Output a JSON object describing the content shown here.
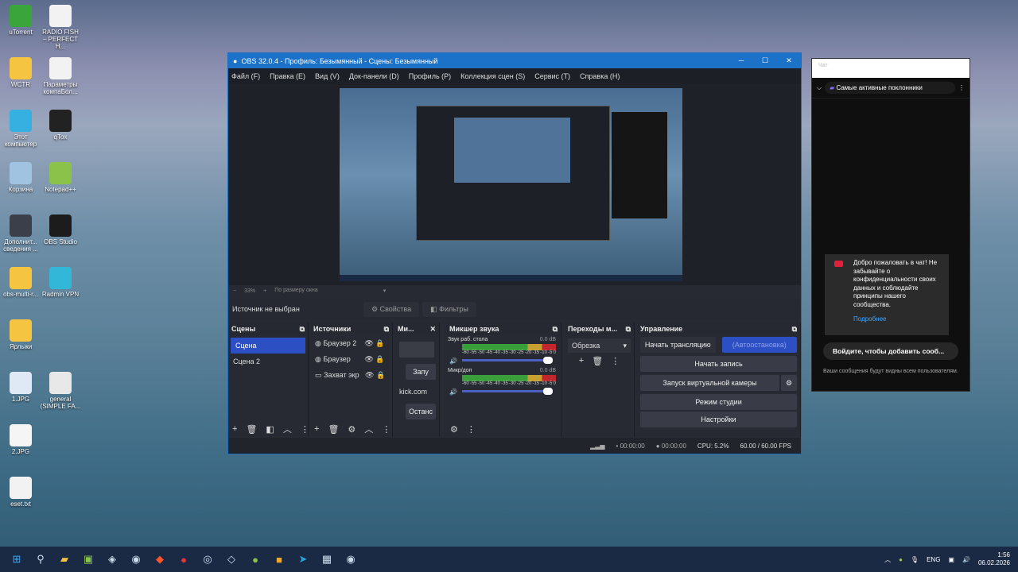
{
  "desktop_icons": [
    {
      "label": "uTorrent",
      "color": "#3aa53a"
    },
    {
      "label": "RADIO FISH – PERFECT H...",
      "color": "#f2f2f2"
    },
    {
      "label": "WCTR",
      "color": "#f5c542"
    },
    {
      "label": "Параметры компаБол...",
      "color": "#f2f2f2"
    },
    {
      "label": "Этот компьютер",
      "color": "#36b0e0"
    },
    {
      "label": "qTox",
      "color": "#222222"
    },
    {
      "label": "Корзина",
      "color": "#9fc3e0"
    },
    {
      "label": "Notepad++",
      "color": "#8bc34a"
    },
    {
      "label": "Дополнит... сведения ...",
      "color": "#3a3f4a"
    },
    {
      "label": "OBS Studio",
      "color": "#1c1c1c"
    },
    {
      "label": "obs-multi-r...",
      "color": "#f5c542"
    },
    {
      "label": "Radmin VPN",
      "color": "#32b7d8"
    },
    {
      "label": "Ярлыки",
      "color": "#f5c542"
    },
    {
      "label": "",
      "color": ""
    },
    {
      "label": "1.JPG",
      "color": "#dfe8f5"
    },
    {
      "label": "general (SIMPLE FA...",
      "color": "#e8e8e8"
    },
    {
      "label": "2.JPG",
      "color": "#f5f5f5"
    },
    {
      "label": "",
      "color": ""
    },
    {
      "label": "eset.txt",
      "color": "#f2f2f2"
    },
    {
      "label": "",
      "color": ""
    }
  ],
  "obs": {
    "title": "OBS 32.0.4 - Профиль: Безымянный - Сцены: Безымянный",
    "menu": [
      "Файл (F)",
      "Правка (E)",
      "Вид (V)",
      "Док-панели (D)",
      "Профиль (P)",
      "Коллекция сцен (S)",
      "Сервис (T)",
      "Справка (H)"
    ],
    "zoom": {
      "minus": "−",
      "value": "33%",
      "plus": "+",
      "fit": "По размеру окна"
    },
    "source_bar": {
      "status": "Источник не выбран",
      "properties": "Свойства",
      "filters": "Фильтры"
    },
    "scenes": {
      "title": "Сцены",
      "items": [
        "Сцена",
        "Сцена 2"
      ],
      "selected": 0
    },
    "sources": {
      "title": "Источники",
      "items": [
        "Браузер 2",
        "Браузер",
        "Захват экр"
      ]
    },
    "mini_dock": {
      "title": "Ми...",
      "start": "Запу",
      "site": "kick.com",
      "stop": "Останс"
    },
    "mixer": {
      "title": "Микшер звука",
      "scale": [
        "-60",
        "-55",
        "-50",
        "-45",
        "-40",
        "-35",
        "-30",
        "-25",
        "-20",
        "-15",
        "-10",
        "-5",
        "0"
      ],
      "channels": [
        {
          "name": "Звук раб. стола",
          "db": "0.0 dB",
          "volume": 1.0
        },
        {
          "name": "Микр/доп",
          "db": "0.0 dB",
          "volume": 1.0
        }
      ]
    },
    "transitions": {
      "title": "Переходы м...",
      "selected": "Обрезка"
    },
    "controls": {
      "title": "Управление",
      "start_stream": "Начать трансляцию",
      "auto_stop": "(Автоостановка)",
      "start_record": "Начать запись",
      "virtual_cam": "Запуск виртуальной камеры",
      "studio_mode": "Режим студии",
      "settings": "Настройки"
    },
    "status": {
      "stream_time": "00:00:00",
      "rec_time": "00:00:00",
      "cpu": "CPU: 5.2%",
      "fps": "60.00 / 60.00 FPS"
    },
    "accent": "#2c4fc4"
  },
  "chat": {
    "window_title": "Чат",
    "filter": "Самые активные поклонники",
    "welcome": "Добро пожаловать в чат! Не забывайте о конфиденциальности своих данных и соблюдайте принципы нашего сообщества.",
    "more": "Подробнее",
    "login": "Войдите, чтобы добавить сооб...",
    "note": "Ваши сообщения будут видны всем пользователям."
  },
  "taskbar": {
    "lang": "ENG",
    "time": "1:56",
    "date": "06.02.2026"
  }
}
